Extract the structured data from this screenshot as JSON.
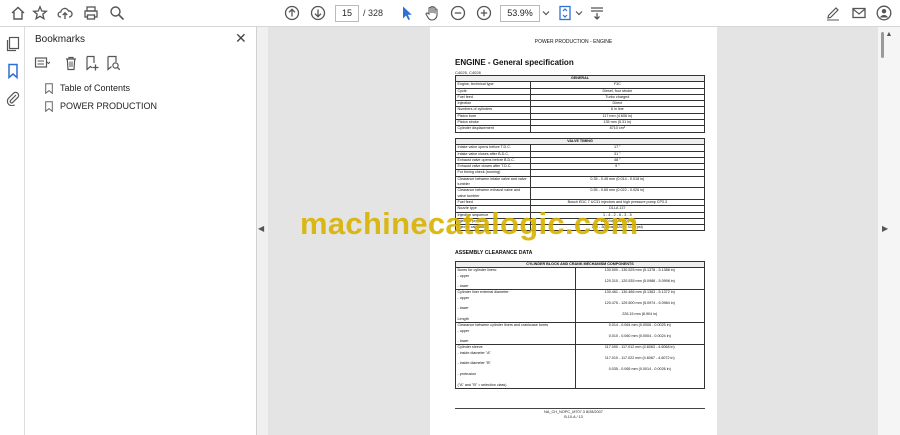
{
  "toolbar": {
    "page_current": "15",
    "page_total": "/ 328",
    "zoom": "53.9%"
  },
  "bookmarks": {
    "title": "Bookmarks",
    "items": [
      "Table of Contents",
      "POWER PRODUCTION"
    ]
  },
  "document": {
    "header": "POWER PRODUCTION - ENGINE",
    "title": "ENGINE - General specification",
    "models": "C4025, C4026",
    "general": {
      "heading": "GENERAL",
      "rows": [
        {
          "label": "Engine, technical type",
          "value": "F3C"
        },
        {
          "label": "Cycle",
          "value": "Diesel, four stroke"
        },
        {
          "label": "Fuel feed",
          "value": "Turbo charged"
        },
        {
          "label": "Injection",
          "value": "Direct"
        },
        {
          "label": "Numbers of cylinders",
          "value": "6 in line"
        },
        {
          "label": "Piston bore",
          "value": "117 mm (4.606 in)"
        },
        {
          "label": "Piston stroke",
          "value": "135 mm (5.31 in)"
        },
        {
          "label": "Cylinder displacement",
          "value": "8710 cm³"
        }
      ]
    },
    "valve_timing": {
      "heading": "VALVE TIMING",
      "rows": [
        {
          "label": "Intake valve opens before T.D.C.",
          "value": "17 °"
        },
        {
          "label": "Intake valve closes after B.D.C.",
          "value": "31 °"
        },
        {
          "label": "Exhaust valve opens before B.D.C.",
          "value": "48 °"
        },
        {
          "label": "Exhaust valve closes after T.D.C.",
          "value": "9 °"
        },
        {
          "label": "For timing check (running)",
          "value": ""
        },
        {
          "label": "Clearance between intake valve and valve tumbler",
          "value": "0.35 - 0.45 mm (0.014 - 0.018 in)"
        },
        {
          "label": "Clearance between exhaust valve and valve tumbler",
          "value": "0.55 - 0.65 mm (0.022 - 0.026 in)"
        },
        {
          "label": "Fuel feed",
          "value": "Bosch EDC 7 UC31 injectors and high pressure pump CP3.3"
        },
        {
          "label": "Nozzle type",
          "value": "DLLA 137"
        },
        {
          "label": "Injection sequence",
          "value": "1 - 4 - 2 - 6 - 3 - 5"
        },
        {
          "label": "Injection pressure",
          "value": "1600 bar (26100 psi)"
        },
        {
          "label": "Injector calibration",
          "value": "290 - 302 bar (4205 - 4379 psi)"
        }
      ]
    },
    "assembly_heading": "ASSEMBLY CLEARANCE DATA",
    "cylinder": {
      "heading": "CYLINDER BLOCK AND CRANK MECHANISM COMPONENTS",
      "groups": [
        {
          "label": "Bores for cylinder liners:\n- upper\n\n- lower",
          "value": "130.500 - 130.525 mm (5.1378 - 5.1388 in)\n\n120.310 - 120.535 mm (5.0988 - 5.0998 in)"
        },
        {
          "label": "Cylinder liner external diameter:\n- upper\n\n- lower\n\nLength",
          "value": "130.461 - 130.486 mm (5.1363 - 5.1372 in)\n\n120.475 - 129.500 mm (5.0974 - 5.0984 in)\n\n226.15 mm (8.904 in)"
        },
        {
          "label": "Clearance between cylinder liners and crankcase bores\n- upper\n\n- lower",
          "value": "0.014 - 0.064 mm (0.0006 - 0.0025 in)\n\n0.010 - 0.060 mm (0.0004 - 0.0024 in)"
        },
        {
          "label": "Cylinder sleeve\n- inside diameter \"A\"\n\n- inside diameter \"B\"\n\n- protrusion\n\n(\"A\" and \"B\" = selection class)",
          "value": "117.000 - 117.012 mm (4.6063 - 4.6068 in)\n\n117.010 - 117.022 mm (4.6067 - 4.6072 in)\n\n0.035 - 0.065 mm (0.0014 - 0.0026 in)"
        }
      ]
    },
    "footer_ref": "NA_CH_NOPC_M707.3 8/28/2007",
    "footer_page": "B.10.A / 13"
  },
  "watermark": "machinecatalogic.com"
}
